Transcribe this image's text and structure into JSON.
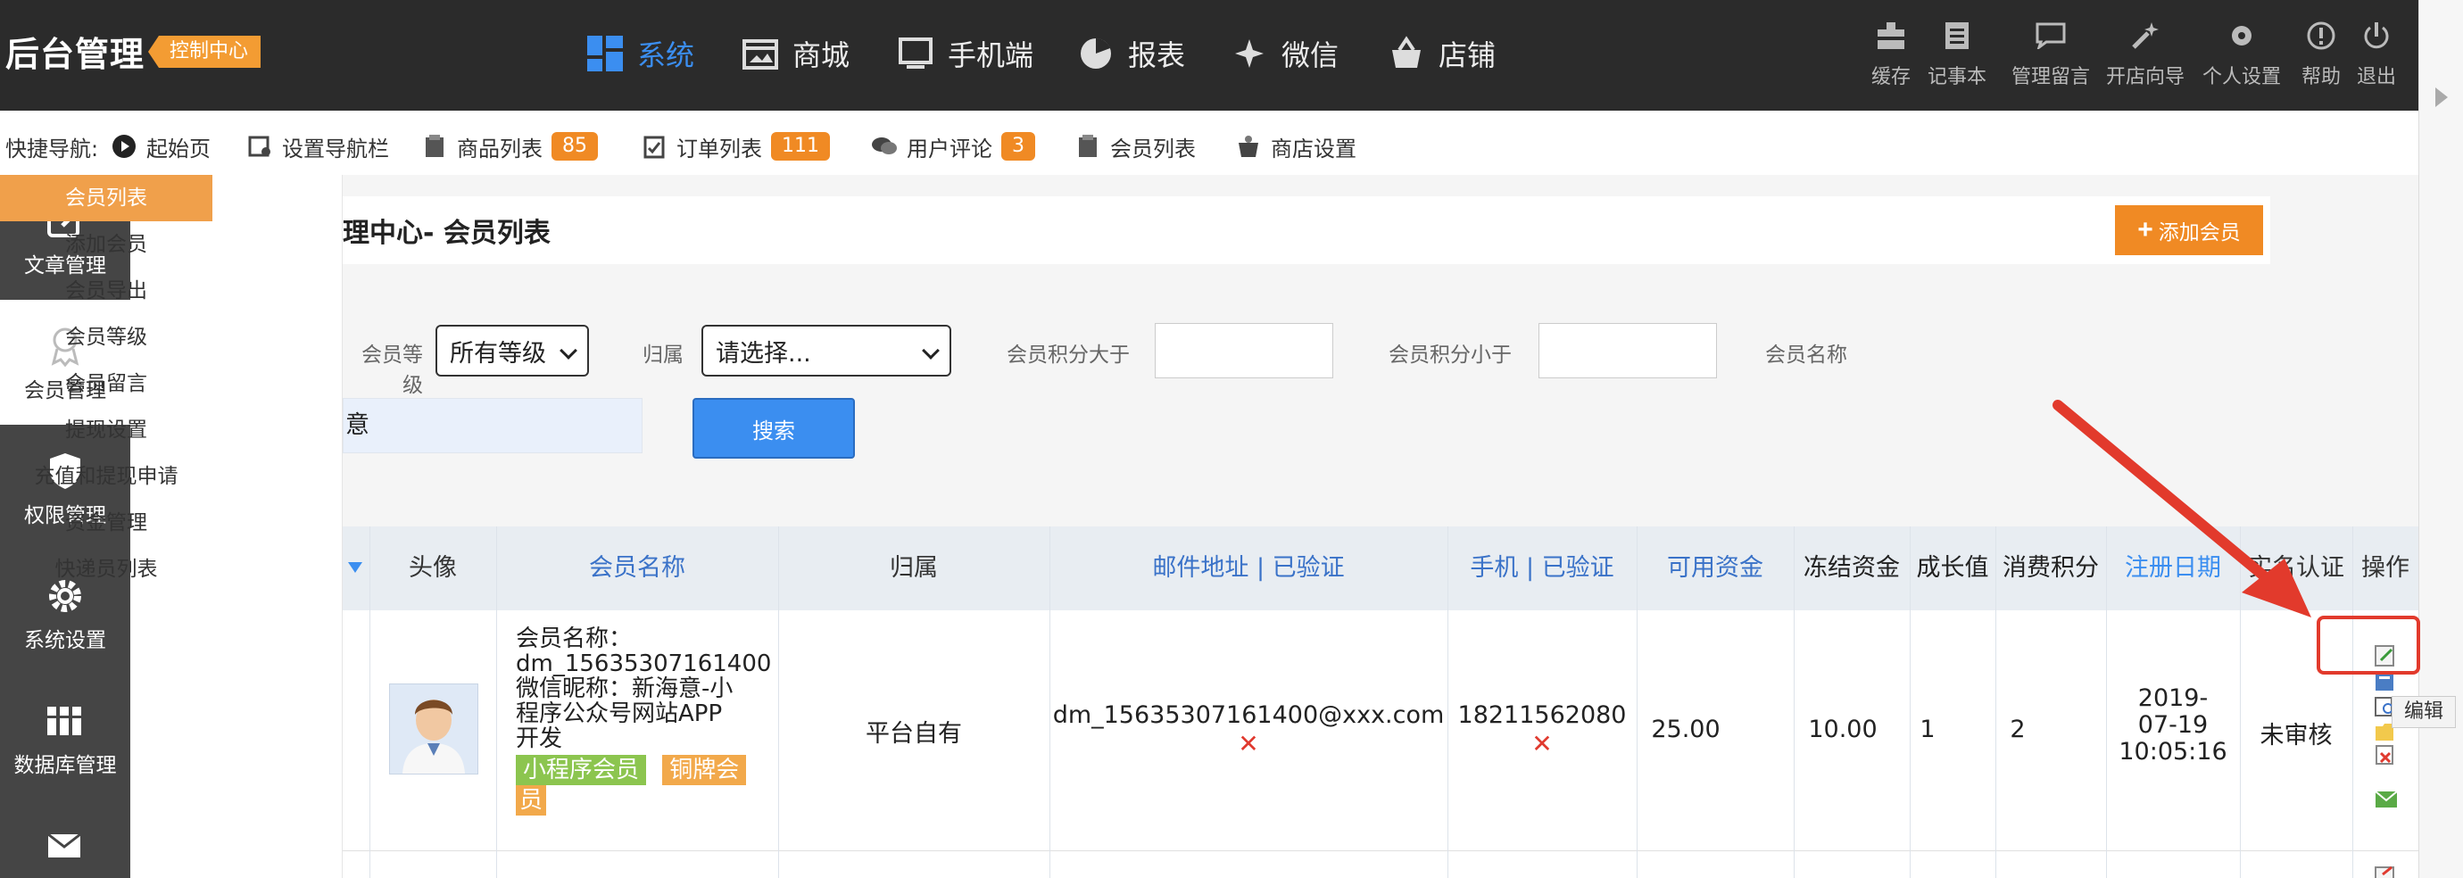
{
  "header": {
    "brand": "后台管理",
    "badge": "控制中心",
    "nav": [
      {
        "label": "系统",
        "icon": "grid-icon"
      },
      {
        "label": "商城",
        "icon": "store-icon"
      },
      {
        "label": "手机端",
        "icon": "monitor-icon"
      },
      {
        "label": "报表",
        "icon": "pie-chart-icon"
      },
      {
        "label": "微信",
        "icon": "wechat-icon"
      },
      {
        "label": "店铺",
        "icon": "basket-icon"
      }
    ],
    "tools": [
      {
        "label": "缓存",
        "icon": "cache-icon"
      },
      {
        "label": "记事本",
        "icon": "notepad-icon"
      },
      {
        "label": "管理留言",
        "icon": "message-icon"
      },
      {
        "label": "开店向导",
        "icon": "wand-icon"
      },
      {
        "label": "个人设置",
        "icon": "gear-icon"
      },
      {
        "label": "帮助",
        "icon": "help-icon"
      },
      {
        "label": "退出",
        "icon": "power-icon"
      }
    ]
  },
  "quicknav": {
    "label": "快捷导航:",
    "items": [
      {
        "label": "起始页",
        "badge": ""
      },
      {
        "label": "设置导航栏",
        "badge": ""
      },
      {
        "label": "商品列表",
        "badge": "85"
      },
      {
        "label": "订单列表",
        "badge": "111"
      },
      {
        "label": "用户评论",
        "badge": "3"
      },
      {
        "label": "会员列表",
        "badge": ""
      },
      {
        "label": "商店设置",
        "badge": ""
      }
    ]
  },
  "sidebar": {
    "items": [
      {
        "label": "文章管理"
      },
      {
        "label": "会员管理"
      },
      {
        "label": "权限管理"
      },
      {
        "label": "系统设置"
      },
      {
        "label": "数据库管理"
      },
      {
        "label": ""
      }
    ]
  },
  "submenu": {
    "items": [
      "会员列表",
      "添加会员",
      "会员导出",
      "会员等级",
      "会员留言",
      "提现设置",
      "充值和提现申请",
      "资金管理",
      "快递员列表"
    ]
  },
  "page": {
    "title": "理中心- 会员列表",
    "add_button": "添加会员"
  },
  "filters": {
    "level_label": "会员等级",
    "level_value": "所有等级",
    "belong_label": "归属",
    "belong_value": "请选择...",
    "points_gt_label": "会员积分大于",
    "points_lt_label": "会员积分小于",
    "name_label": "会员名称",
    "name_value": "意",
    "search_button": "搜索"
  },
  "table": {
    "headers": [
      "头像",
      "会员名称",
      "归属",
      "邮件地址 | 已验证",
      "手机 | 已验证",
      "可用资金",
      "冻结资金",
      "成长值",
      "消费积分",
      "注册日期",
      "实名认证",
      "操作"
    ],
    "rows": [
      {
        "name_line1": "会员名称：",
        "name_line2": "dm_15635307161400",
        "name_line3": "微信昵称：新海意-小",
        "name_line4": "程序公众号网站APP",
        "name_line5": "开发",
        "tag1": "小程序会员",
        "tag2_a": "铜牌会",
        "tag2_b": "员",
        "belong": "平台自有",
        "email": "dm_15635307161400@xxx.com",
        "email_verified": "✕",
        "phone": "18211562080",
        "phone_verified": "✕",
        "available": "25.00",
        "frozen": "10.00",
        "growth": "1",
        "points": "2",
        "date_a": "2019-",
        "date_b": "07-19",
        "date_c": "10:05:16",
        "realname": "未审核"
      }
    ]
  },
  "tooltip": "编辑",
  "colors": {
    "topbar": "#2b2b2b",
    "accent_orange": "#f08a24",
    "accent_blue": "#3b8ef0",
    "sidebar": "#454545",
    "annotation_red": "#e23a2c"
  }
}
